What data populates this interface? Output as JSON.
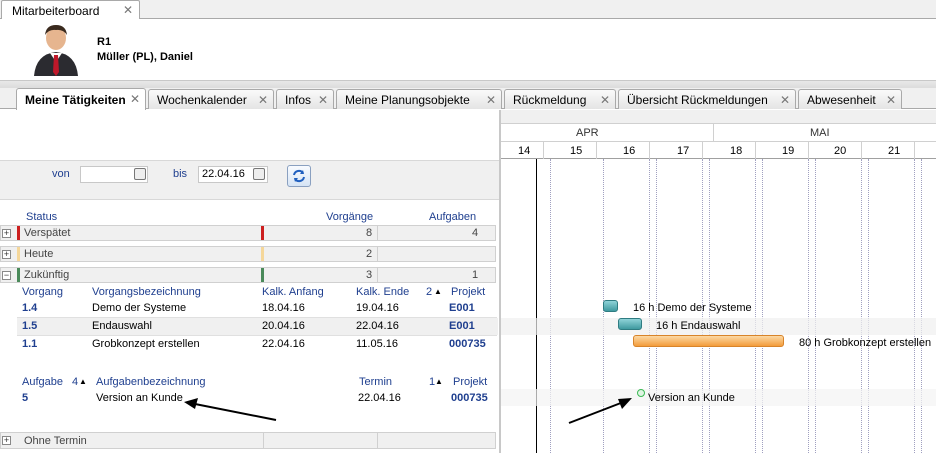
{
  "top_tab": {
    "label": "Mitarbeiterboard"
  },
  "header": {
    "resource_code": "R1",
    "resource_name": "Müller (PL), Daniel"
  },
  "tabs": [
    {
      "label": "Meine Tätigkeiten",
      "active": true
    },
    {
      "label": "Wochenkalender"
    },
    {
      "label": "Infos"
    },
    {
      "label": "Meine Planungsobjekte"
    },
    {
      "label": "Rückmeldung"
    },
    {
      "label": "Übersicht Rückmeldungen"
    },
    {
      "label": "Abwesenheit"
    }
  ],
  "filter": {
    "from_label": "von",
    "from_value": "",
    "to_label": "bis",
    "to_value": "22.04.16"
  },
  "status_table": {
    "headers": {
      "status": "Status",
      "vorgaenge": "Vorgänge",
      "aufgaben": "Aufgaben"
    },
    "rows": [
      {
        "label": "Verspätet",
        "vorgaenge": "8",
        "aufgaben": "4",
        "color": "#cc1f1f"
      },
      {
        "label": "Heute",
        "vorgaenge": "2",
        "aufgaben": "",
        "color": "#f5d79a"
      },
      {
        "label": "Zukünftig",
        "vorgaenge": "3",
        "aufgaben": "1",
        "color": "#4a8a5a"
      }
    ]
  },
  "vorgang_table": {
    "headers": {
      "vorgang": "Vorgang",
      "bezeichnung": "Vorgangsbezeichnung",
      "anfang": "Kalk. Anfang",
      "ende": "Kalk. Ende",
      "sort": "2",
      "projekt": "Projekt"
    },
    "rows": [
      {
        "id": "1.4",
        "name": "Demo der Systeme",
        "start": "18.04.16",
        "end": "19.04.16",
        "projekt": "E001"
      },
      {
        "id": "1.5",
        "name": "Endauswahl",
        "start": "20.04.16",
        "end": "22.04.16",
        "projekt": "E001"
      },
      {
        "id": "1.1",
        "name": "Grobkonzept erstellen",
        "start": "22.04.16",
        "end": "11.05.16",
        "projekt": "000735"
      }
    ]
  },
  "aufgabe_table": {
    "headers": {
      "aufgabe": "Aufgabe",
      "sort1": "4",
      "bezeichnung": "Aufgabenbezeichnung",
      "termin": "Termin",
      "sort2": "1",
      "projekt": "Projekt"
    },
    "rows": [
      {
        "id": "5",
        "name": "Version an Kunde",
        "termin": "22.04.16",
        "projekt": "000735"
      }
    ]
  },
  "ohne_termin": {
    "label": "Ohne Termin"
  },
  "gantt": {
    "months": [
      "APR",
      "MAI"
    ],
    "weeks": [
      "14",
      "15",
      "16",
      "17",
      "18",
      "19",
      "20",
      "21"
    ],
    "bars": [
      {
        "label": "16 h  Demo der Systeme"
      },
      {
        "label": "16 h  Endauswahl"
      },
      {
        "label": "80 h  Grobkonzept erstellen"
      }
    ],
    "milestone": {
      "label": "Version an Kunde"
    }
  },
  "colors": {
    "accent_blue": "#1f3f8f",
    "bar_teal": "#5fb3b8",
    "bar_orange": "#f7b561",
    "milestone_green": "#3cba55"
  }
}
